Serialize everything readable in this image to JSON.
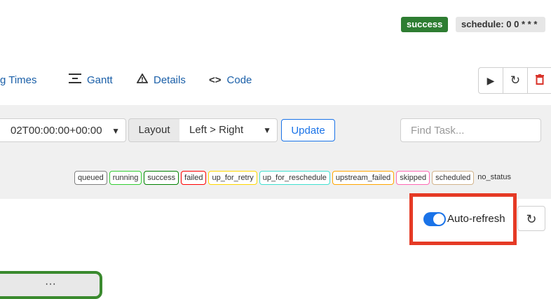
{
  "header": {
    "status_badge": "success",
    "schedule_badge": "schedule: 0 0 * * *"
  },
  "nav": {
    "items": [
      {
        "label": "g Times",
        "icon": ""
      },
      {
        "label": "Gantt",
        "icon": "gantt-icon"
      },
      {
        "label": "Details",
        "icon": "warning-triangle-icon"
      },
      {
        "label": "Code",
        "icon": "code-icon"
      }
    ]
  },
  "action_buttons": {
    "icons": [
      "play-icon",
      "refresh-icon",
      "trash-icon"
    ]
  },
  "controls": {
    "date_value": "02T00:00:00+00:00",
    "layout_label": "Layout",
    "layout_value": "Left > Right",
    "update_label": "Update",
    "find_placeholder": "Find Task..."
  },
  "legend": {
    "states": [
      {
        "label": "queued",
        "color": "#808080"
      },
      {
        "label": "running",
        "color": "#32cd32"
      },
      {
        "label": "success",
        "color": "#008000"
      },
      {
        "label": "failed",
        "color": "#ff0000"
      },
      {
        "label": "up_for_retry",
        "color": "#ffd700"
      },
      {
        "label": "up_for_reschedule",
        "color": "#40e0d0"
      },
      {
        "label": "upstream_failed",
        "color": "#ffa500"
      },
      {
        "label": "skipped",
        "color": "#ff69b4"
      },
      {
        "label": "scheduled",
        "color": "#d2b48c"
      },
      {
        "label": "no_status",
        "color": ""
      }
    ]
  },
  "refresh": {
    "label": "Auto-refresh",
    "enabled": true
  },
  "graph": {
    "node_text": "···"
  },
  "colors": {
    "accent": "#1a73e8",
    "highlight": "#e53a25",
    "success": "#2e7d32"
  }
}
